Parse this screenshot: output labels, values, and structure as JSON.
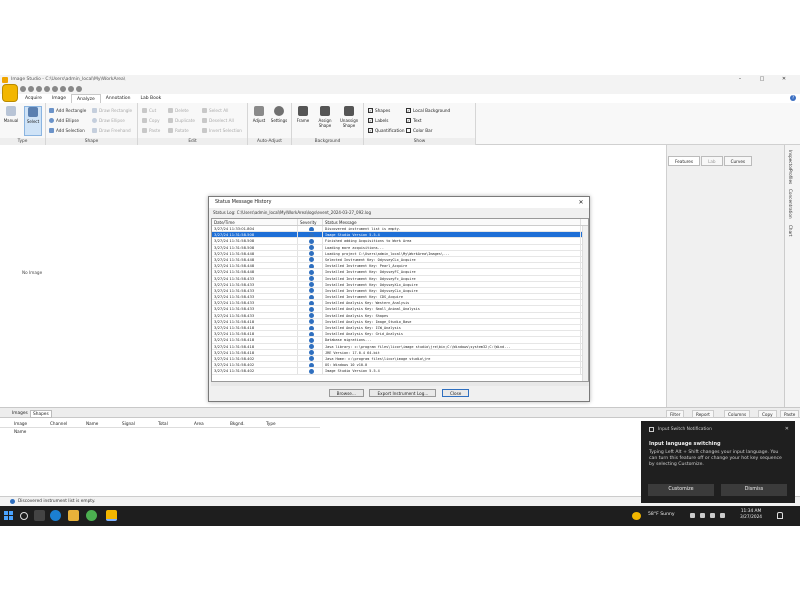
{
  "window": {
    "title": "Image Studio - C:\\Users\\admin_local\\My\\WorkArea\\",
    "minimize": "–",
    "maximize": "□",
    "close": "✕"
  },
  "tabs": [
    "Acquire",
    "Image",
    "Analyze",
    "Annotation",
    "Lab Book"
  ],
  "active_tab": "Analyze",
  "ribbon": {
    "type_group": {
      "label": "Type",
      "manual": "Manual",
      "select": "Select"
    },
    "shape_group": {
      "label": "Shape",
      "add_rectangle": "Add Rectangle",
      "add_ellipse": "Add Ellipse",
      "add_selection": "Add Selection",
      "draw_rectangle": "Draw Rectangle",
      "draw_ellipse": "Draw Ellipse",
      "draw_freehand": "Draw Freehand"
    },
    "edit_group": {
      "label": "Edit",
      "cut": "Cut",
      "copy": "Copy",
      "paste": "Paste",
      "delete": "Delete",
      "duplicate": "Duplicate",
      "rotate": "Rotate",
      "select_all": "Select All",
      "deselect_all": "Deselect All",
      "invert_selection": "Invert Selection"
    },
    "auto_adjust_group": {
      "label": "Auto-Adjust",
      "adjust": "Adjust",
      "settings": "Settings"
    },
    "background_group": {
      "label": "Background",
      "frame": "Frame",
      "assign_shape": "Assign Shape",
      "unassign_shape": "Unassign Shape"
    },
    "show_group": {
      "label": "Show",
      "shapes": "Shapes",
      "labels": "Labels",
      "quantification": "Quantification",
      "local_background": "Local Background",
      "text": "Text",
      "color_bar": "Color Bar"
    }
  },
  "main": {
    "no_image": "No Image"
  },
  "right_panel": {
    "tabs": [
      "Features",
      "Lab",
      "Curves"
    ],
    "side_tabs": [
      "Inspector",
      "Profiles",
      "Concentration",
      "Chart"
    ]
  },
  "dialog": {
    "title": "Status Message History",
    "close": "✕",
    "log_path": "Status Log:  C:\\Users\\admin_local\\My\\WorkArea\\logs\\event_2024-03-27_092.log",
    "columns": [
      "Date/Time",
      "Severity",
      "Status Message"
    ],
    "rows": [
      {
        "time": "3/27/24 11:33:01.804",
        "msg": "Discovered instrument list is empty."
      },
      {
        "time": "3/27/24 11:31:58.508",
        "msg": "Image Studio Version 5.5.4"
      },
      {
        "time": "3/27/24 11:31:58.508",
        "msg": "Finished adding Acquisitions to Work Area"
      },
      {
        "time": "3/27/24 11:31:58.508",
        "msg": "Loading more acquisitions..."
      },
      {
        "time": "3/27/24 11:31:58.448",
        "msg": "Loading project C:\\Users\\admin_local\\My\\WorkArea\\Images\\..."
      },
      {
        "time": "3/27/24 11:31:58.448",
        "msg": "Selected Instrument Key: OdysseyCLx_Acquire"
      },
      {
        "time": "3/27/24 11:31:58.448",
        "msg": "Installed Instrument Key: Pearl_Acquire"
      },
      {
        "time": "3/27/24 11:31:58.448",
        "msg": "Installed Instrument Key: OdysseyFC_Acquire"
      },
      {
        "time": "3/27/24 11:31:58.433",
        "msg": "Installed Instrument Key: OdysseyFc_Acquire"
      },
      {
        "time": "3/27/24 11:31:58.433",
        "msg": "Installed Instrument Key: OdysseyXLx_Acquire"
      },
      {
        "time": "3/27/24 11:31:58.433",
        "msg": "Installed Instrument Key: OdysseyCLx_Acquire"
      },
      {
        "time": "3/27/24 11:31:58.433",
        "msg": "Installed Instrument Key: CDS_Acquire"
      },
      {
        "time": "3/27/24 11:31:58.433",
        "msg": "Installed Analysis Key: Western_Analysis"
      },
      {
        "time": "3/27/24 11:31:58.433",
        "msg": "Installed Analysis Key: Small_Animal_Analysis"
      },
      {
        "time": "3/27/24 11:31:58.433",
        "msg": "Installed Analysis Key: Shapes"
      },
      {
        "time": "3/27/24 11:31:58.418",
        "msg": "Installed Analysis Key: Image_Studio_Base"
      },
      {
        "time": "3/27/24 11:31:58.418",
        "msg": "Installed Analysis Key: ICW_Analysis"
      },
      {
        "time": "3/27/24 11:31:58.418",
        "msg": "Installed Analysis Key: Grid_Analysis"
      },
      {
        "time": "3/27/24 11:31:58.418",
        "msg": "Database migrations..."
      },
      {
        "time": "3/27/24 11:31:58.418",
        "msg": "Java library: c:\\program files\\licor\\image studio\\jre\\bin;C:\\Windows\\system32;C:\\Wind..."
      },
      {
        "time": "3/27/24 11:31:58.418",
        "msg": "JRE Version: 17.0.4 64-bit"
      },
      {
        "time": "3/27/24 11:31:58.402",
        "msg": "Java Home: c:\\program files\\licor\\image studio\\jre"
      },
      {
        "time": "3/27/24 11:31:58.402",
        "msg": "OS: Windows 10 v10.0"
      },
      {
        "time": "3/27/24 11:31:58.402",
        "msg": "Image Studio Version 5.5.4"
      }
    ],
    "selected_row": 1,
    "buttons": {
      "browse": "Browse...",
      "export": "Export Instrument Log...",
      "close": "Close"
    }
  },
  "bottom": {
    "tabs": [
      "Images",
      "Shapes"
    ],
    "active_tab": "Shapes",
    "tools": [
      "Filter",
      "Report",
      "Columns",
      "Copy",
      "Paste"
    ],
    "columns": [
      "Image Name",
      "Channel",
      "Name",
      "Signal",
      "Total",
      "Area",
      "Bkgnd.",
      "Type"
    ],
    "status": "Discovered instrument list is empty."
  },
  "toast": {
    "header": "Input Switch Notification",
    "close": "✕",
    "title": "Input language switching",
    "body": "Typing Left Alt + Shift changes your input language. You can turn this feature off or change your hot key sequence by selecting Customize.",
    "customize": "Customize",
    "dismiss": "Dismiss"
  },
  "taskbar": {
    "weather": "58°F  Sunny",
    "time": "11:34 AM",
    "date": "3/27/2024"
  },
  "colors": {
    "accent": "#1e6fd6",
    "app_orb": "#f2b600",
    "taskbar": "#1e1e1e"
  }
}
